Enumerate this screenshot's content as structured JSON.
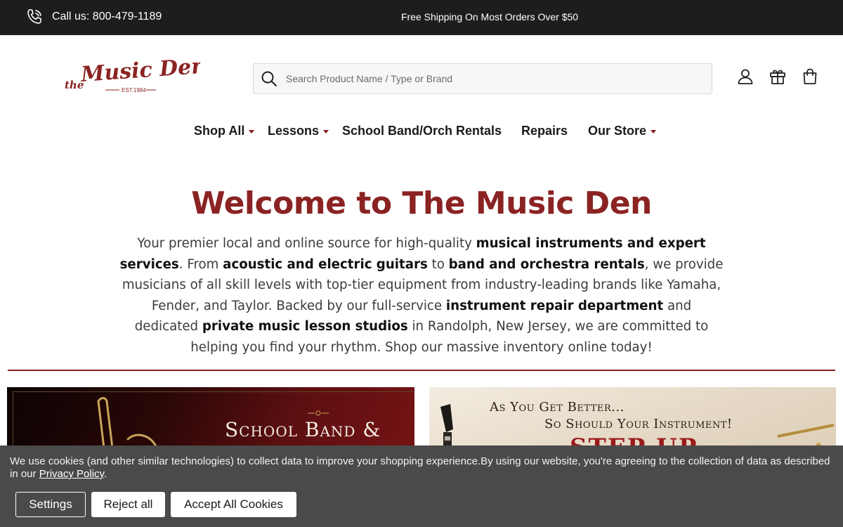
{
  "topbar": {
    "phone_label": "Call us: 800-479-1189",
    "promo": "Free Shipping On Most Orders Over $50"
  },
  "logo": {
    "prefix": "the",
    "name": "Music Den",
    "est": "EST.1984"
  },
  "search": {
    "placeholder": "Search Product Name / Type or Brand"
  },
  "header_icons": [
    "account-icon",
    "gift-icon",
    "cart-icon"
  ],
  "nav": [
    {
      "label": "Shop All",
      "has_dropdown": true
    },
    {
      "label": "Lessons",
      "has_dropdown": true
    },
    {
      "label": "School Band/Orch Rentals",
      "has_dropdown": false
    },
    {
      "label": "Repairs",
      "has_dropdown": false
    },
    {
      "label": "Our Store",
      "has_dropdown": true
    }
  ],
  "hero": {
    "title": "Welcome to The Music Den",
    "intro_parts": [
      {
        "text": "Your premier local and online source for high-quality ",
        "bold": false
      },
      {
        "text": "musical instruments and expert services",
        "bold": true
      },
      {
        "text": ". From ",
        "bold": false
      },
      {
        "text": "acoustic and electric guitars",
        "bold": true
      },
      {
        "text": " to ",
        "bold": false
      },
      {
        "text": "band and orchestra rentals",
        "bold": true
      },
      {
        "text": ", we provide musicians of all skill levels with top-tier equipment from industry-leading brands like Yamaha, Fender, and Taylor. Backed by our full-service ",
        "bold": false
      },
      {
        "text": "instrument repair department",
        "bold": true
      },
      {
        "text": " and dedicated ",
        "bold": false
      },
      {
        "text": "private music lesson studios",
        "bold": true
      },
      {
        "text": " in Randolph, New Jersey, we are committed to helping you find your rhythm. Shop our massive inventory online today!",
        "bold": false
      }
    ]
  },
  "banners": {
    "left_title": "School Band &",
    "right_line1": "As You Get Better...",
    "right_line2": "So Should Your Instrument!",
    "right_line3": "STEP UP"
  },
  "cookie": {
    "text": "We use cookies (and other similar technologies) to collect data to improve your shopping experience.By using our website, you're agreeing to the collection of data as described in our ",
    "link": "Privacy Policy",
    "after": ".",
    "settings_label": "Settings",
    "reject_label": "Reject all",
    "accept_label": "Accept All Cookies"
  },
  "colors": {
    "topbar_bg": "#1d1d1d",
    "brand_red": "#8b2323",
    "cookie_bg": "#4a4a4a"
  }
}
